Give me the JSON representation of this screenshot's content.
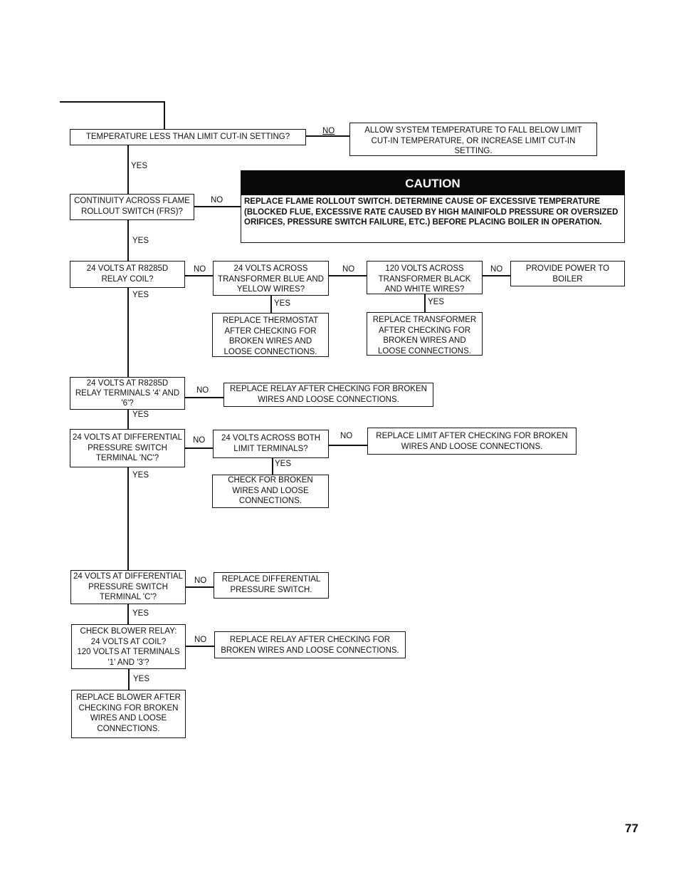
{
  "flowchart": {
    "q_temperature": "TEMPERATURE LESS THAN LIMIT CUT-IN SETTING?",
    "a_allow_temperature": "ALLOW SYSTEM TEMPERATURE TO FALL BELOW LIMIT\nCUT-IN TEMPERATURE, OR INCREASE LIMIT CUT-IN\nSETTING.",
    "q_continuity_frs": "CONTINUITY ACROSS FLAME\nROLLOUT SWITCH (FRS)?",
    "caution": {
      "title": "CAUTION",
      "text": "REPLACE FLAME ROLLOUT SWITCH. DETERMINE CAUSE OF EXCESSIVE TEMPERATURE (BLOCKED FLUE, EXCESSIVE RATE CAUSED BY HIGH MAINIFOLD PRESSURE OR OVERSIZED ORIFICES, PRESSURE SWITCH FAILURE, ETC.) BEFORE PLACING BOILER IN OPERATION."
    },
    "q_relay_coil": "24 VOLTS AT R8285D\nRELAY COIL?",
    "q_transformer_blue_yellow": "24 VOLTS ACROSS\nTRANSFORMER BLUE AND\nYELLOW WIRES?",
    "q_transformer_black_white": "120 VOLTS ACROSS\nTRANSFORMER BLACK\nAND WHITE WIRES?",
    "a_provide_power": "PROVIDE POWER TO\nBOILER",
    "a_replace_thermostat": "REPLACE THERMOSTAT\nAFTER CHECKING FOR\nBROKEN WIRES AND\nLOOSE CONNECTIONS.",
    "a_replace_transformer": "REPLACE TRANSFORMER\nAFTER CHECKING FOR\nBROKEN WIRES AND\nLOOSE CONNECTIONS.",
    "q_relay_terminals": "24 VOLTS AT R8285D\nRELAY TERMINALS '4' AND\n'6'?",
    "a_replace_relay_1": "REPLACE RELAY AFTER CHECKING FOR BROKEN\nWIRES AND LOOSE CONNECTIONS.",
    "q_diff_switch_nc": "24 VOLTS AT DIFFERENTIAL\nPRESSURE SWITCH\nTERMINAL 'NC'?",
    "q_limit_terminals": "24 VOLTS ACROSS BOTH\nLIMIT TERMINALS?",
    "a_replace_limit": "REPLACE LIMIT AFTER CHECKING FOR BROKEN\nWIRES AND LOOSE CONNECTIONS.",
    "a_check_broken_wires": "CHECK FOR BROKEN\nWIRES AND LOOSE\nCONNECTIONS.",
    "q_diff_switch_c": "24 VOLTS AT DIFFERENTIAL\nPRESSURE SWITCH\nTERMINAL 'C'?",
    "a_replace_diff_switch": "REPLACE DIFFERENTIAL\nPRESSURE SWITCH.",
    "q_blower_relay": "CHECK BLOWER RELAY:\n24 VOLTS AT COIL?\n120 VOLTS AT TERMINALS\n'1' AND '3'?",
    "a_replace_relay_2": "REPLACE RELAY AFTER CHECKING FOR\nBROKEN WIRES AND LOOSE CONNECTIONS.",
    "a_replace_blower": "REPLACE BLOWER AFTER\nCHECKING FOR BROKEN\nWIRES AND LOOSE\nCONNECTIONS.",
    "yes_label": "YES",
    "no_label": "NO"
  },
  "page_number": "77"
}
